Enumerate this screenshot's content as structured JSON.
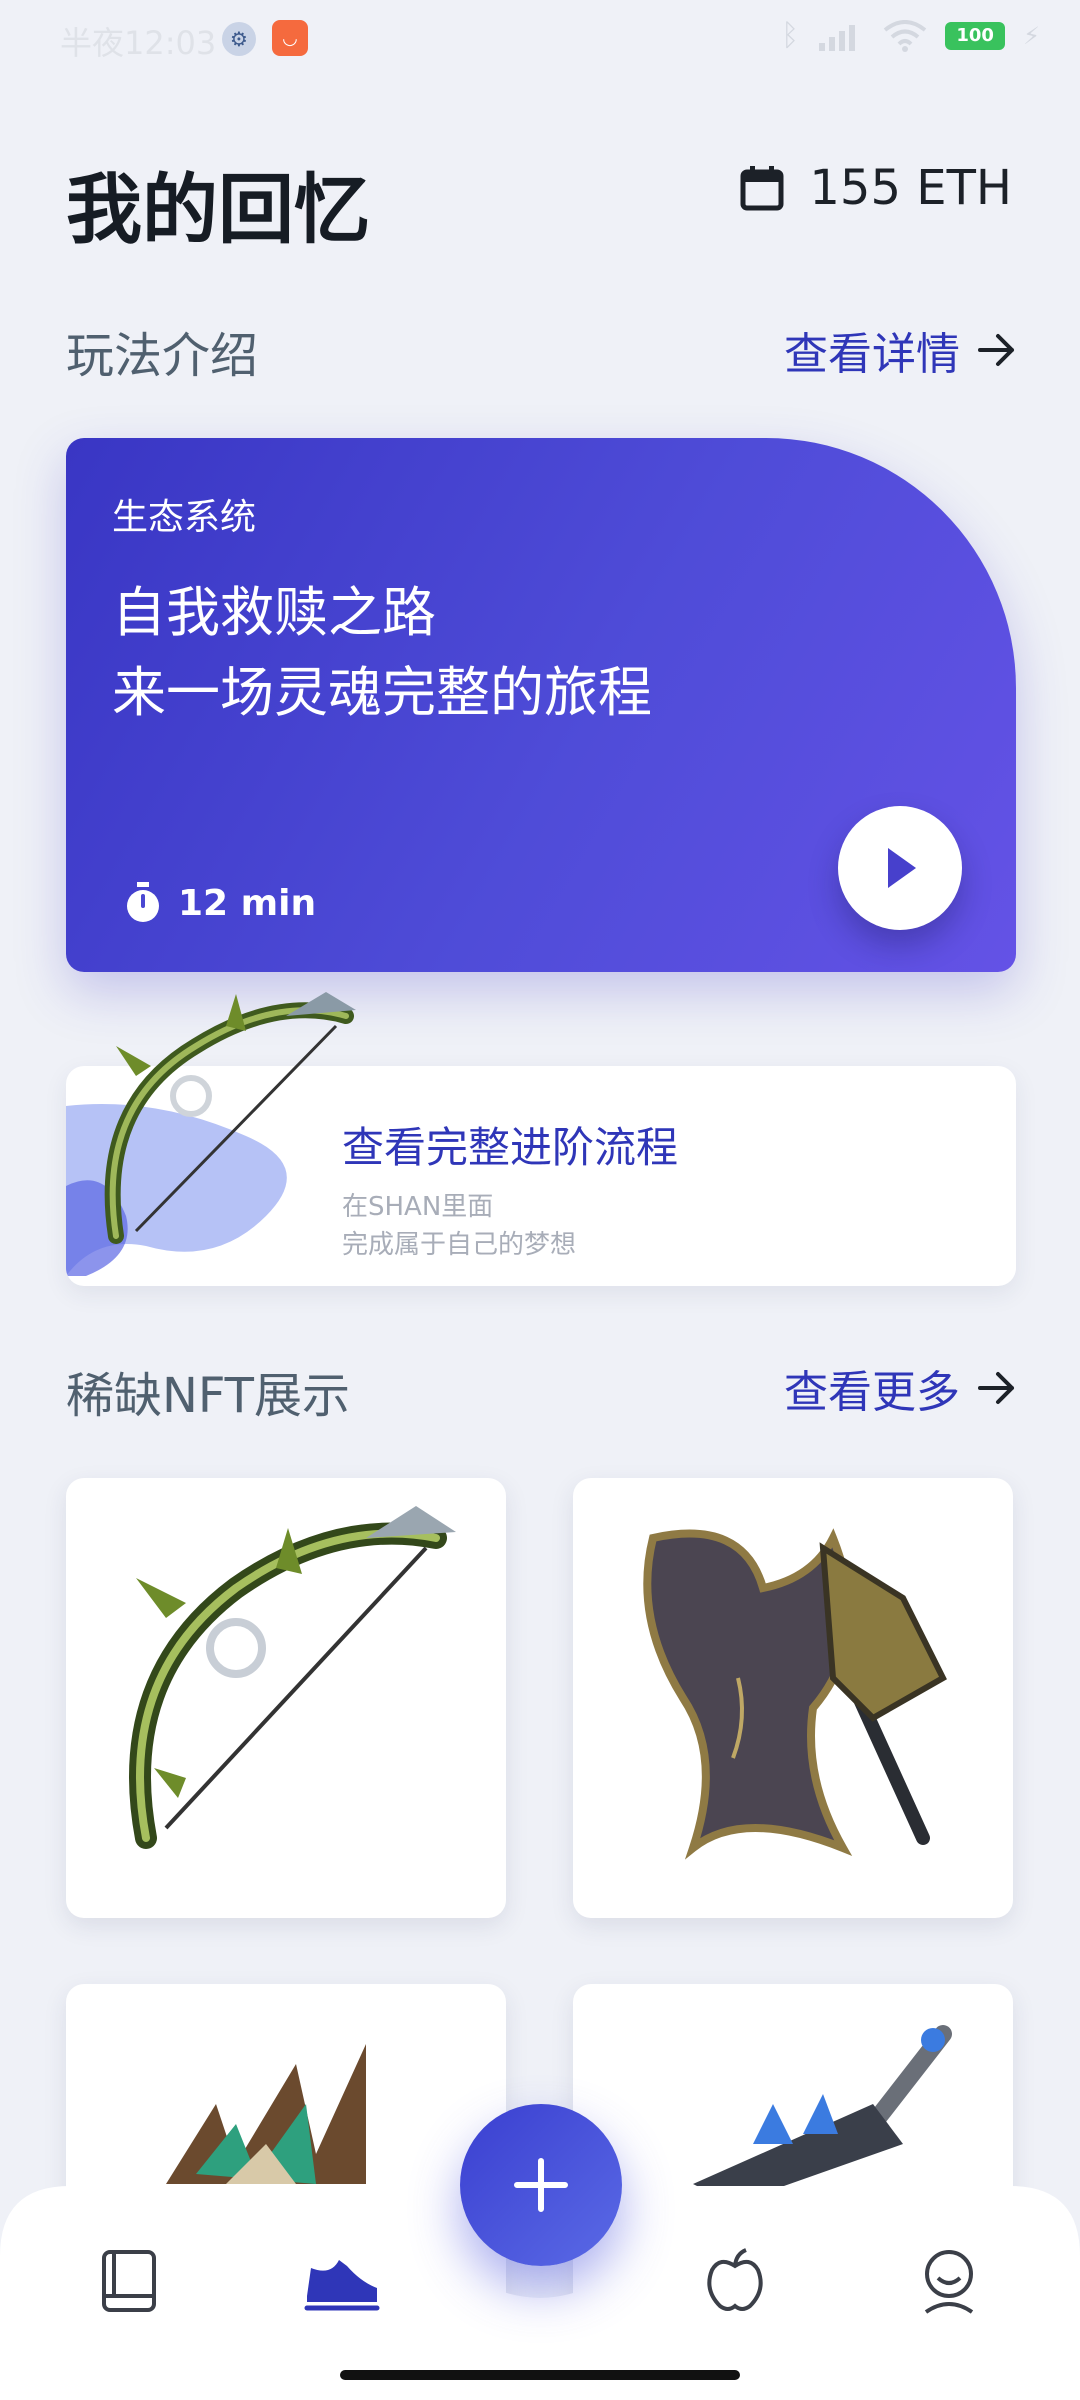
{
  "status_bar": {
    "time": "半夜12:03",
    "battery": "100"
  },
  "header": {
    "title": "我的回忆",
    "balance": "155 ETH",
    "balance_icon": "calendar-icon"
  },
  "intro_section": {
    "title": "玩法介绍",
    "link": "查看详情"
  },
  "hero_card": {
    "tag": "生态系统",
    "line1": "自我救赎之路",
    "line2": "来一场灵魂完整的旅程",
    "duration": "12 min",
    "gradient_start": "#3936c4",
    "gradient_end": "#6452e6"
  },
  "progress_card": {
    "title": "查看完整进阶流程",
    "subtitle1": "在SHAN里面",
    "subtitle2": "完成属于自己的梦想"
  },
  "nft_section": {
    "title": "稀缺NFT展示",
    "link": "查看更多",
    "items": [
      {
        "icon": "bow-icon"
      },
      {
        "icon": "axe-icon"
      },
      {
        "icon": "feather-blade-icon"
      },
      {
        "icon": "sword-icon"
      }
    ]
  },
  "bottom_nav": {
    "items": [
      {
        "icon": "book-icon",
        "active": false
      },
      {
        "icon": "sneaker-icon",
        "active": true
      },
      {
        "icon": "apple-icon",
        "active": false
      },
      {
        "icon": "profile-icon",
        "active": false
      }
    ],
    "fab_icon": "plus-icon"
  },
  "colors": {
    "accent": "#2f36b8",
    "background": "#eff1f7"
  }
}
